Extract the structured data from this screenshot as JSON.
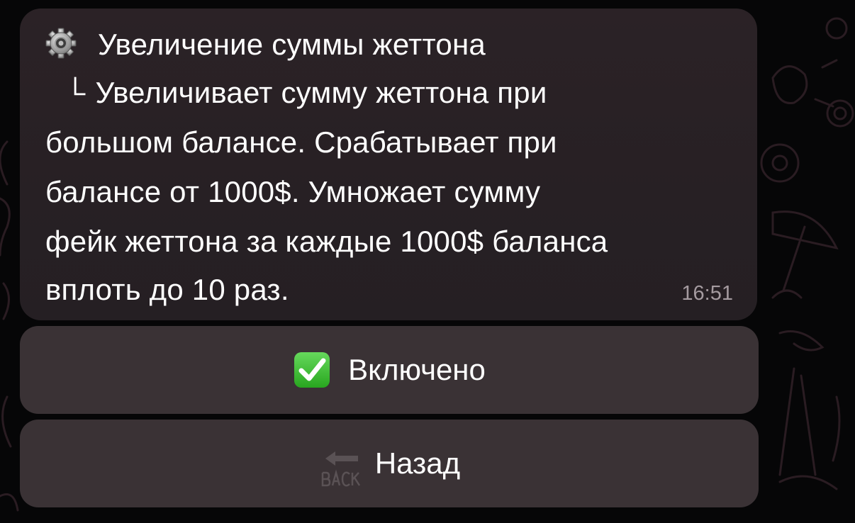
{
  "message": {
    "title": "Увеличение суммы жеттона",
    "subline_mark": "└",
    "lines": [
      "Увеличивает сумму жеттона при",
      "большом балансе. Срабатывает при",
      "балансе от 1000$. Умножает сумму",
      "фейк жеттона за каждые 1000$ баланса",
      "вплоть до 10 раз."
    ],
    "time": "16:51",
    "title_icon": "gear-icon"
  },
  "buttons": {
    "enabled_label": "Включено",
    "enabled_icon": "check-mark-icon",
    "back_label": "Назад",
    "back_icon": "back-arrow-icon"
  },
  "colors": {
    "bubble": "#2b2226",
    "button": "#3a3235",
    "check_green": "#34b233",
    "time_text": "#a59ba0"
  }
}
